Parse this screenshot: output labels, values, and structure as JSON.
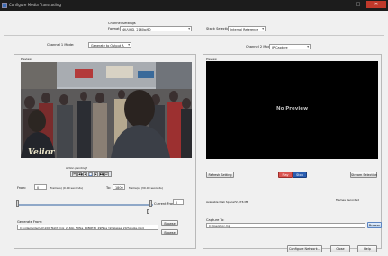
{
  "window": {
    "title": "Configure Media Transcoding"
  },
  "format": {
    "label": "Format:",
    "value": "4K/UHD, 2160p/60"
  },
  "stack_selection": {
    "label": "Stack Selection:",
    "value": "Internal Reference"
  },
  "channel_settings": {
    "title": "Channel Settings"
  },
  "channel1": {
    "label": "Channel 1 Mode:",
    "value": "Generate to Output A"
  },
  "channel2": {
    "label": "Channel 2 Mode:",
    "value": "IP Capture"
  },
  "left_preview_label": "Preview",
  "right_preview_label": "Preview",
  "video_watermark": "Velior",
  "no_preview": "No Preview",
  "action_pending": "Action pending?",
  "transport": [
    "⏮",
    "◀◀",
    "◀",
    "■",
    "▶",
    "▶▶",
    "⏭"
  ],
  "from": {
    "label": "From:",
    "value": "0",
    "suffix": "frame(s)  (0.00 seconds)"
  },
  "to": {
    "label": "To:",
    "value": "1800",
    "suffix": "frame(s)  (30.00 seconds)"
  },
  "current_frame": {
    "label": "Current Frame:",
    "value": "0"
  },
  "generate_from": {
    "label": "Generate From:",
    "value": "C:\\video\\video\\4K\\100_flight_mix_2160p_59fps_1080P30_29f9ba_timelapse_20/fullsize.mp4"
  },
  "buttons": {
    "browse_left": "Browse",
    "browse_left2": "Browse",
    "refresh_settings": "Refresh Setting",
    "stream_selection": "Stream Selection",
    "browse_capture": "Browse",
    "configure_network": "Configure Network...",
    "close": "Close",
    "help": "Help",
    "play": "Play",
    "stop": "Stop"
  },
  "disk_space": {
    "label": "Available Disk Space:",
    "value": "72,376 MB"
  },
  "frames_recorded": "Frames Recorded",
  "capture_to": {
    "label": "Capture To:",
    "value": "C:\\Users\\joc.mp"
  },
  "colors": {
    "accent_play": "#d9534f",
    "accent_stop": "#2a5db0"
  }
}
